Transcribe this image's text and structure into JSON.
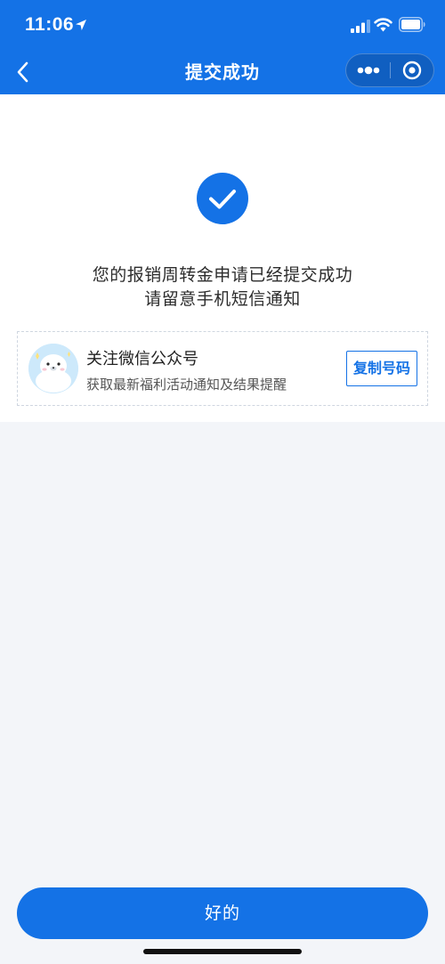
{
  "status_bar": {
    "time": "11:06"
  },
  "nav": {
    "title": "提交成功"
  },
  "result": {
    "line1": "您的报销周转金申请已经提交成功",
    "line2": "请留意手机短信通知"
  },
  "follow_card": {
    "title": "关注微信公众号",
    "subtitle": "获取最新福利活动通知及结果提醒",
    "copy_label": "复制号码"
  },
  "footer": {
    "ok_label": "好的"
  },
  "colors": {
    "primary": "#1472e6",
    "page_background": "#f3f5f9",
    "card_border": "#cfd6e0"
  },
  "icons": {
    "back": "back-icon",
    "more": "more-icon",
    "close": "close-icon",
    "success": "checkmark-circle-icon",
    "avatar": "seal-mascot-avatar"
  }
}
